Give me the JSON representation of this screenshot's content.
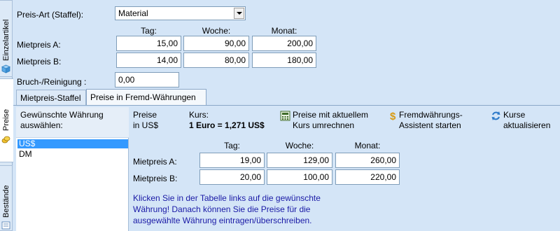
{
  "side_tabs": [
    {
      "label": "Einzelartikel",
      "icon": "cube-icon"
    },
    {
      "label": "Preise",
      "icon": "coins-icon"
    },
    {
      "label": "Bestände",
      "icon": "stock-icon"
    }
  ],
  "top": {
    "price_type_label": "Preis-Art (Staffel):",
    "price_type_value": "Material",
    "col_headers": [
      "Tag:",
      "Woche:",
      "Monat:"
    ],
    "rows": [
      {
        "label": "Mietpreis A:",
        "values": [
          "15,00",
          "90,00",
          "200,00"
        ]
      },
      {
        "label": "Mietpreis B:",
        "values": [
          "14,00",
          "80,00",
          "180,00"
        ]
      }
    ],
    "breakage_label": "Bruch-/Reinigung :",
    "breakage_value": "0,00"
  },
  "tabs": [
    {
      "label": "Mietpreis-Staffel"
    },
    {
      "label": "Preise in Fremd-Währungen"
    }
  ],
  "currency": {
    "header_line1": "Gewünschte Währung",
    "header_line2": "auswählen:",
    "items": [
      "US$",
      "DM"
    ],
    "selected": "US$"
  },
  "foreign": {
    "prices_line1": "Preise",
    "prices_line2": "in  US$",
    "rate_label": "Kurs:",
    "rate_value": "1 Euro = 1,271 US$",
    "convert_line1": "Preise mit aktuellem",
    "convert_line2": "Kurs umrechnen",
    "assistant_line1": "Fremdwährungs-",
    "assistant_line2": "Assistent starten",
    "update_line1": "Kurse",
    "update_line2": "aktualisieren",
    "col_headers": [
      "Tag:",
      "Woche:",
      "Monat:"
    ],
    "rows": [
      {
        "label": "Mietpreis A:",
        "values": [
          "19,00",
          "129,00",
          "260,00"
        ]
      },
      {
        "label": "Mietpreis B:",
        "values": [
          "20,00",
          "100,00",
          "220,00"
        ]
      }
    ],
    "note": "Klicken Sie in der Tabelle links auf die gewünschte Währung! Danach können Sie die Preise für die ausgewählte Währung eintragen/überschreiben."
  },
  "colors": {
    "background": "#d4e5f7",
    "selection": "#3399ff",
    "note_text": "#1a1aa6"
  }
}
